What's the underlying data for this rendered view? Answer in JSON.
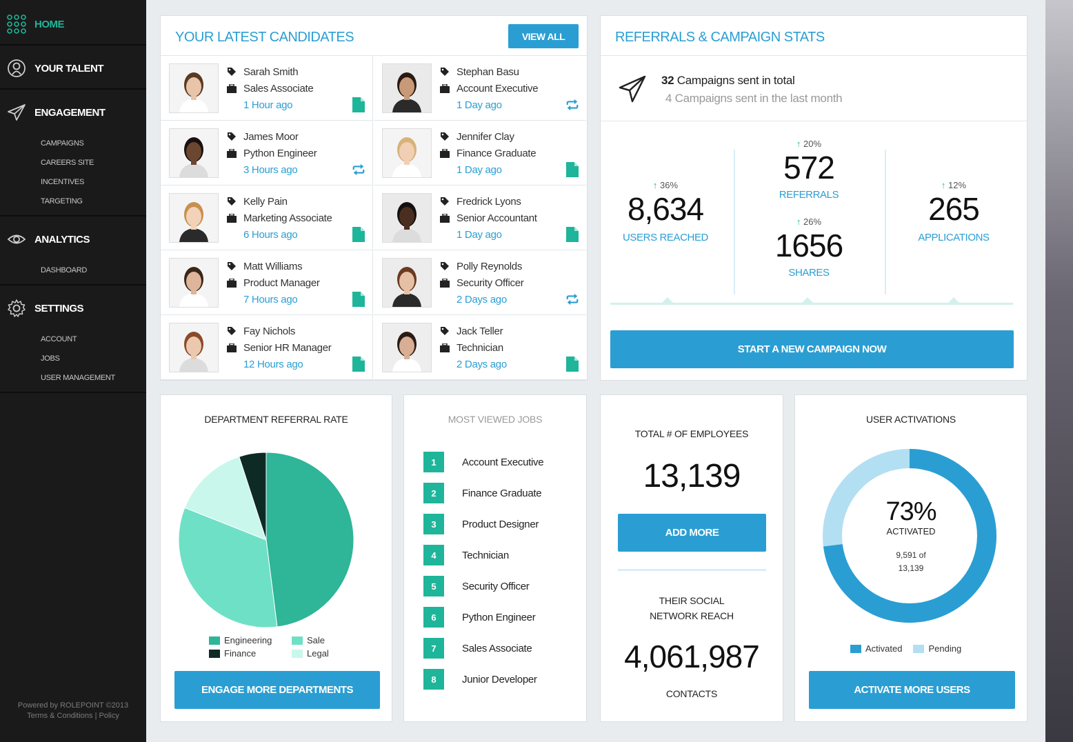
{
  "sidebar": {
    "items": [
      {
        "label": "HOME",
        "icon": "grid-icon",
        "subs": []
      },
      {
        "label": "YOUR TALENT",
        "icon": "user-circle-icon",
        "subs": []
      },
      {
        "label": "ENGAGEMENT",
        "icon": "paper-plane-icon",
        "subs": [
          "CAMPAIGNS",
          "CAREERS SITE",
          "INCENTIVES",
          "TARGETING"
        ]
      },
      {
        "label": "ANALYTICS",
        "icon": "eye-icon",
        "subs": [
          "DASHBOARD"
        ]
      },
      {
        "label": "SETTINGS",
        "icon": "gear-icon",
        "subs": [
          "ACCOUNT",
          "JOBS",
          "USER MANAGEMENT"
        ]
      }
    ],
    "footer_line1": "Powered by ROLEPOINT ©2013",
    "footer_line2": "Terms & Conditions | Policy"
  },
  "candidates": {
    "title": "YOUR LATEST CANDIDATES",
    "view_all": "VIEW ALL",
    "list": [
      {
        "name": "Sarah Smith",
        "role": "Sales Associate",
        "time": "1 Hour ago",
        "action": "document-icon"
      },
      {
        "name": "Stephan Basu",
        "role": "Account Executive",
        "time": "1 Day ago",
        "action": "refresh-icon"
      },
      {
        "name": "James Moor",
        "role": "Python Engineer",
        "time": "3 Hours ago",
        "action": "refresh-icon"
      },
      {
        "name": "Jennifer Clay",
        "role": "Finance Graduate",
        "time": "1 Day ago",
        "action": "document-icon"
      },
      {
        "name": "Kelly Pain",
        "role": "Marketing Associate",
        "time": "6 Hours ago",
        "action": "document-icon"
      },
      {
        "name": "Fredrick Lyons",
        "role": "Senior Accountant",
        "time": "1 Day ago",
        "action": "document-icon"
      },
      {
        "name": "Matt Williams",
        "role": "Product Manager",
        "time": "7 Hours ago",
        "action": "document-icon"
      },
      {
        "name": "Polly Reynolds",
        "role": "Security Officer",
        "time": "2 Days ago",
        "action": "refresh-icon"
      },
      {
        "name": "Fay Nichols",
        "role": "Senior HR Manager",
        "time": "12 Hours ago",
        "action": "document-icon"
      },
      {
        "name": "Jack Teller",
        "role": "Technician",
        "time": "2 Days ago",
        "action": "document-icon"
      }
    ]
  },
  "referrals": {
    "title": "REFERRALS & CAMPAIGN STATS",
    "campaigns_total_num": "32",
    "campaigns_total_text": "Campaigns sent in total",
    "campaigns_month_num": "4",
    "campaigns_month_text": "Campaigns sent in the last month",
    "users_reached": {
      "pct": "36%",
      "value": "8,634",
      "label": "USERS REACHED"
    },
    "referrals_stat": {
      "pct": "20%",
      "value": "572",
      "label": "REFERRALS"
    },
    "shares": {
      "pct": "26%",
      "value": "1656",
      "label": "SHARES"
    },
    "applications": {
      "pct": "12%",
      "value": "265",
      "label": "APPLICATIONS"
    },
    "button": "START A NEW CAMPAIGN NOW"
  },
  "dept": {
    "title": "DEPARTMENT REFERRAL RATE",
    "button": "ENGAGE MORE DEPARTMENTS",
    "legend": [
      {
        "label": "Engineering",
        "color": "#2fb597"
      },
      {
        "label": "Sale",
        "color": "#6ee0c6"
      },
      {
        "label": "Finance",
        "color": "#0e2a24"
      },
      {
        "label": "Legal",
        "color": "#c9f7ec"
      }
    ]
  },
  "chart_data": {
    "type": "pie",
    "title": "DEPARTMENT REFERRAL RATE",
    "categories": [
      "Engineering",
      "Sale",
      "Legal",
      "Finance"
    ],
    "values": [
      48,
      33,
      14,
      5
    ],
    "colors": [
      "#2fb597",
      "#6ee0c6",
      "#c9f7ec",
      "#0e2a24"
    ]
  },
  "jobs": {
    "title": "MOST VIEWED JOBS",
    "list": [
      "Account Executive",
      "Finance Graduate",
      "Product Designer",
      "Technician",
      "Security Officer",
      "Python Engineer",
      "Sales Associate",
      "Junior Developer"
    ]
  },
  "employees": {
    "title": "TOTAL # OF EMPLOYEES",
    "value": "13,139",
    "button": "ADD MORE",
    "reach_title_line1": "THEIR SOCIAL",
    "reach_title_line2": "NETWORK REACH",
    "reach_value": "4,061,987",
    "reach_label": "CONTACTS"
  },
  "activations": {
    "title": "USER ACTIVATIONS",
    "percent": "73%",
    "activated_label": "ACTIVATED",
    "detail_line1": "9,591 of",
    "detail_line2": "13,139",
    "activated_fraction": 0.73,
    "legend_activated": "Activated",
    "legend_pending": "Pending",
    "color_activated": "#2a9ed3",
    "color_pending": "#b3dff3",
    "button": "ACTIVATE MORE USERS"
  }
}
